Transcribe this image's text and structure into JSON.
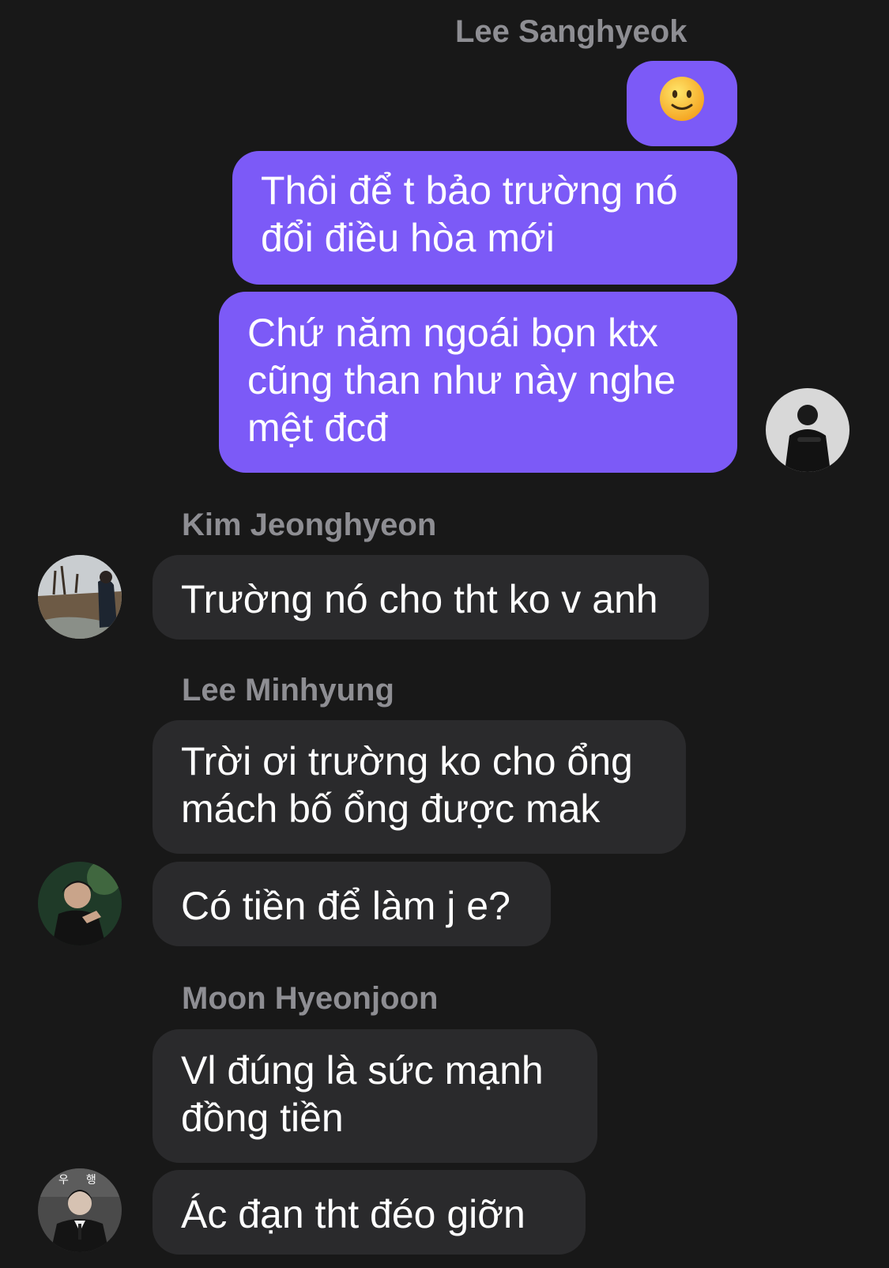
{
  "chat": {
    "outgoing": {
      "sender": "Lee Sanghyeok",
      "emoji_icon": "slightly-smiling-face-icon",
      "messages": [
        "Thôi để t bảo trường nó\nđổi điều hòa mới",
        "Chứ năm ngoái bọn ktx\ncũng than như này nghe\nmệt đcđ"
      ]
    },
    "incoming": [
      {
        "sender": "Kim Jeonghyeon",
        "messages": [
          "Trường nó cho tht ko v anh"
        ]
      },
      {
        "sender": "Lee Minhyung",
        "messages": [
          "Trời ơi trường ko cho ổng\nmách bố ổng được mak",
          "Có tiền để làm j e?"
        ]
      },
      {
        "sender": "Moon Hyeonjoon",
        "messages": [
          "Vl đúng là sức mạnh\nđồng tiền",
          "Ác đạn tht đéo giỡn"
        ]
      }
    ],
    "avatar_badge_text": "우행"
  },
  "colors": {
    "background": "#181818",
    "outgoing_bubble": "#7c5af7",
    "incoming_bubble": "#2a2a2c",
    "sender_name": "#8e8e93",
    "text": "#ffffff"
  }
}
